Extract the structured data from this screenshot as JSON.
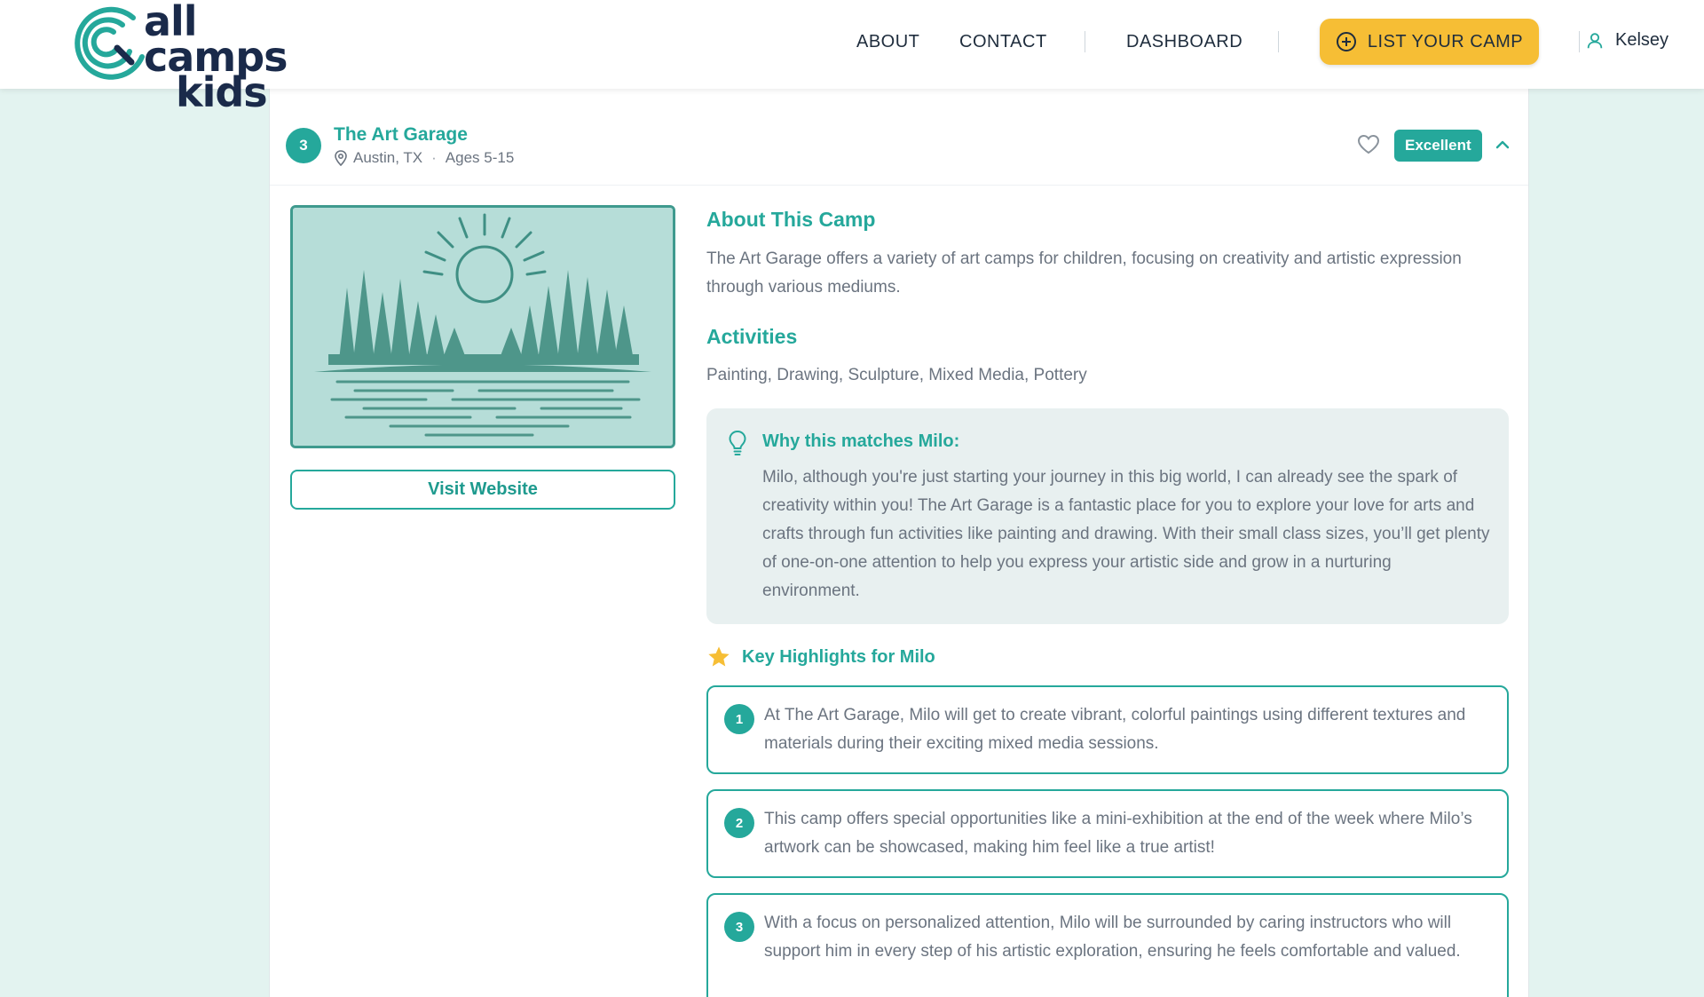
{
  "header": {
    "logo_line1": "all camps",
    "logo_line2": "kids",
    "nav": {
      "about": "ABOUT",
      "contact": "CONTACT",
      "dashboard": "DASHBOARD"
    },
    "list_camp_label": "LIST YOUR CAMP",
    "user_name": "Kelsey"
  },
  "camp": {
    "rank": "3",
    "name": "The Art Garage",
    "location": "Austin, TX",
    "ages": "Ages 5-15",
    "rating": "Excellent",
    "visit_label": "Visit Website",
    "about_title": "About This Camp",
    "about_text": "The Art Garage offers a variety of art camps for children, focusing on creativity and artistic expression through various mediums.",
    "activities_title": "Activities",
    "activities_text": "Painting, Drawing, Sculpture, Mixed Media, Pottery",
    "match_title": "Why this matches Milo:",
    "match_text": "Milo, although you're just starting your journey in this big world, I can already see the spark of creativity within you! The Art Garage is a fantastic place for you to explore your love for arts and crafts through fun activities like painting and drawing. With their small class sizes, you’ll get plenty of one-on-one attention to help you express your artistic side and grow in a nurturing environment.",
    "highlights_title": "Key Highlights for Milo",
    "highlights": [
      {
        "num": "1",
        "text": "At The Art Garage, Milo will get to create vibrant, colorful paintings using different textures and materials during their exciting mixed media sessions."
      },
      {
        "num": "2",
        "text": "This camp offers special opportunities like a mini-exhibition at the end of the week where Milo’s artwork can be showcased, making him feel like a true artist!"
      },
      {
        "num": "3",
        "text": "With a focus on personalized attention, Milo will be surrounded by caring instructors who will support him in every step of his artistic exploration, ensuring he feels comfortable and valued."
      }
    ]
  },
  "colors": {
    "accent": "#25a89b",
    "cta": "#f6be35",
    "background": "#e3f3f0"
  },
  "icons": [
    "logo-mark-icon",
    "plus-circle-icon",
    "user-icon",
    "map-pin-icon",
    "heart-icon",
    "chevron-up-icon",
    "lightbulb-icon",
    "star-icon"
  ]
}
